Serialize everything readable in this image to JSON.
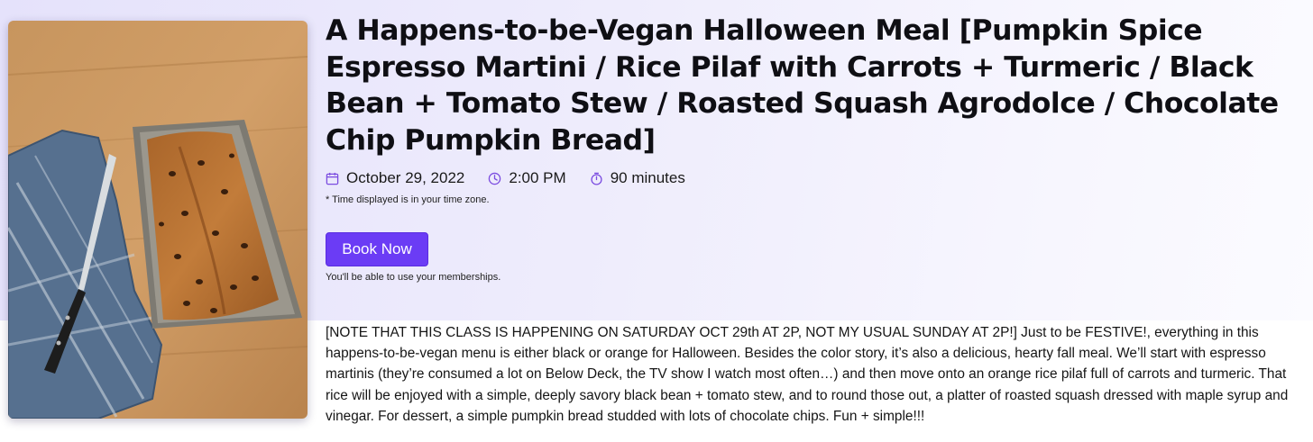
{
  "event": {
    "title": "A Happens-to-be-Vegan Halloween Meal [Pumpkin Spice Espresso Martini / Rice Pilaf with Carrots + Turmeric / Black Bean + Tomato Stew / Roasted Squash Agrodolce / Chocolate Chip Pumpkin Bread]",
    "date": "October 29, 2022",
    "time": "2:00 PM",
    "duration": "90 minutes",
    "timezone_note": "* Time displayed is in your time zone.",
    "book_label": "Book Now",
    "membership_note": "You'll be able to use your memberships.",
    "description": "[NOTE THAT THIS CLASS IS HAPPENING ON SATURDAY OCT 29th AT 2P, NOT MY USUAL SUNDAY AT 2P!] Just to be FESTIVE!, everything in this happens-to-be-vegan menu is either black or orange for Halloween. Besides the color story, it’s also a delicious, hearty fall meal. We’ll start with espresso martinis (they’re consumed a lot on Below Deck, the TV show I watch most often…) and then move onto an orange rice pilaf full of carrots and turmeric. That rice will be enjoyed with a simple, deeply savory black bean + tomato stew, and to round those out, a platter of roasted squash dressed with maple syrup and vinegar. For dessert, a simple pumpkin bread studded with lots of chocolate chips. Fun + simple!!!"
  },
  "icons": {
    "date": "calendar-icon",
    "time": "clock-icon",
    "duration": "stopwatch-icon"
  },
  "colors": {
    "accent": "#6b3cf5",
    "icon": "#7b4ce0",
    "hero_background": "#ebe8fc"
  }
}
